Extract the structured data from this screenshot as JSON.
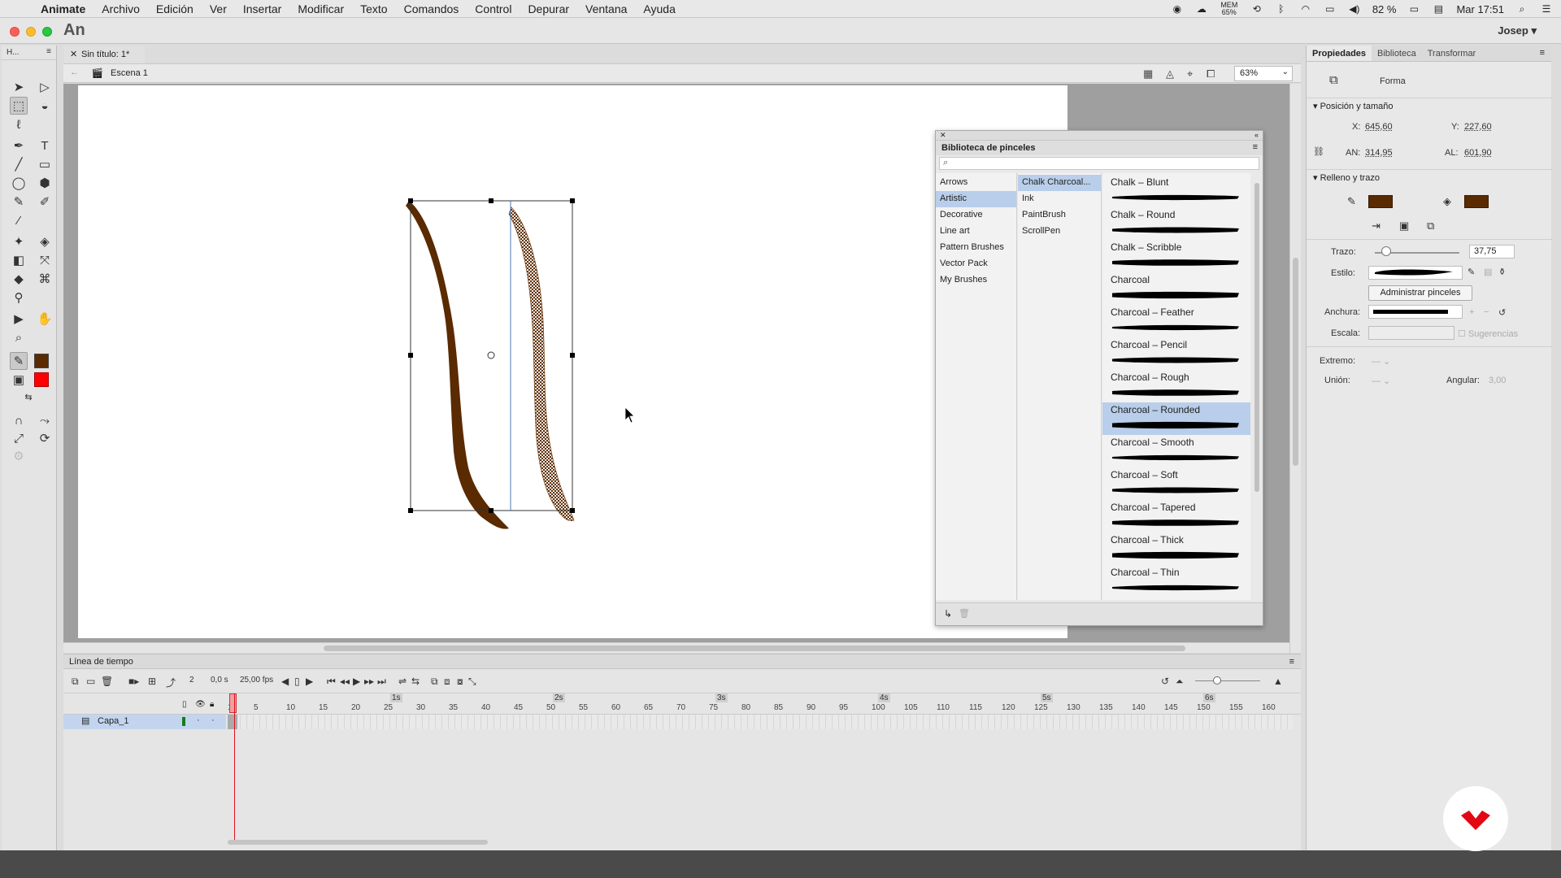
{
  "menubar": {
    "app": "Animate",
    "items": [
      "Archivo",
      "Edición",
      "Ver",
      "Insertar",
      "Modificar",
      "Texto",
      "Comandos",
      "Control",
      "Depurar",
      "Ventana",
      "Ayuda"
    ],
    "battery": "82 %",
    "memory": "MEM\n65%",
    "clock": "Mar 17:51"
  },
  "titlebar": {
    "logo": "An",
    "user": "Josep"
  },
  "tools": {
    "header": "H..."
  },
  "document": {
    "tab": "Sin título: 1*",
    "scene": "Escena 1",
    "zoom": "63%"
  },
  "brush_library": {
    "title": "Biblioteca de pinceles",
    "categories": [
      "Arrows",
      "Artistic",
      "Decorative",
      "Line art",
      "Pattern Brushes",
      "Vector Pack",
      "My Brushes"
    ],
    "selected_category": "Artistic",
    "subcategories": [
      "Chalk Charcoal...",
      "Ink",
      "PaintBrush",
      "ScrollPen"
    ],
    "selected_subcategory": "Chalk Charcoal...",
    "brushes": [
      "Chalk – Blunt",
      "Chalk – Round",
      "Chalk – Scribble",
      "Charcoal",
      "Charcoal – Feather",
      "Charcoal – Pencil",
      "Charcoal – Rough",
      "Charcoal – Rounded",
      "Charcoal – Smooth",
      "Charcoal – Soft",
      "Charcoal – Tapered",
      "Charcoal – Thick",
      "Charcoal – Thin"
    ],
    "selected_brush": "Charcoal – Rounded"
  },
  "properties": {
    "tabs": [
      "Propiedades",
      "Biblioteca",
      "Transformar"
    ],
    "object_type": "Forma",
    "position_section": "Posición y tamaño",
    "x_label": "X:",
    "x_value": "645,60",
    "y_label": "Y:",
    "y_value": "227,60",
    "w_label": "AN:",
    "w_value": "314,95",
    "h_label": "AL:",
    "h_value": "601,90",
    "fill_section": "Relleno y trazo",
    "stroke_label": "Trazo:",
    "stroke_value": "37,75",
    "style_label": "Estilo:",
    "manage_brushes": "Administrar pinceles",
    "width_label": "Anchura:",
    "scale_label": "Escala:",
    "hints_label": "Sugerencias",
    "cap_label": "Extremo:",
    "join_label": "Unión:",
    "angular_label": "Angular:",
    "angular_value": "3,00",
    "colors": {
      "stroke": "#5a2a00",
      "fill": "#5a2a00"
    }
  },
  "timeline": {
    "title": "Línea de tiempo",
    "frame": "2",
    "time": "0,0 s",
    "fps": "25,00 fps",
    "layer": "Capa_1",
    "ruler_marks": [
      "1",
      "5",
      "10",
      "15",
      "20",
      "25",
      "30",
      "35",
      "40",
      "45",
      "50",
      "55",
      "60",
      "65",
      "70",
      "75",
      "80",
      "85",
      "90",
      "95",
      "100",
      "105",
      "110",
      "115",
      "120",
      "125",
      "130",
      "135",
      "140",
      "145",
      "150",
      "155",
      "160"
    ],
    "second_marks": [
      "1s",
      "2s",
      "3s",
      "4s",
      "5s",
      "6s"
    ]
  },
  "colors": {
    "accent_selection": "#b8ceea",
    "stroke_brown": "#5a2a00",
    "swatch_red": "#ff0000",
    "brand_red": "#e30613"
  }
}
